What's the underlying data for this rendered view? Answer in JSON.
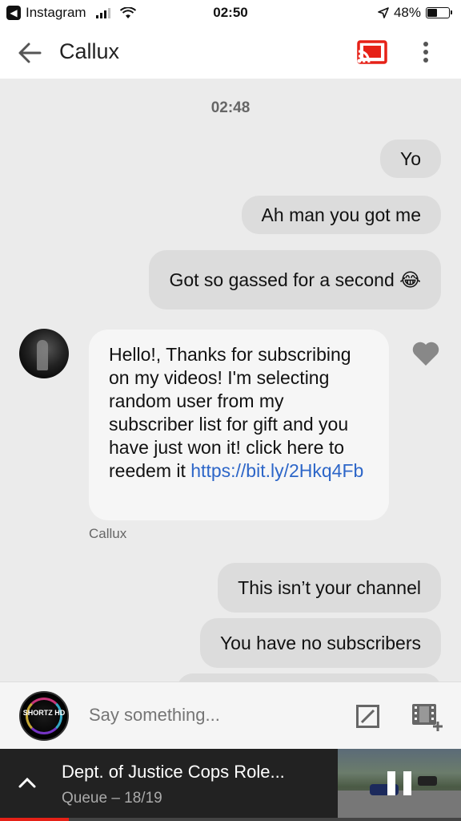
{
  "status_bar": {
    "app_name": "Instagram",
    "time": "02:50",
    "battery_percent": "48%",
    "battery_level": 0.48
  },
  "header": {
    "title": "Callux",
    "cast_color": "#e62117"
  },
  "chat": {
    "timestamp": "02:48",
    "outgoing_top": [
      {
        "text": "Yo"
      },
      {
        "text": "Ah man you got me"
      },
      {
        "text": "Got so gassed for a second 😂"
      }
    ],
    "incoming": {
      "text": "Hello!, Thanks for subscribing on my videos! I'm selecting random user from my subscriber list for gift and you have just won it! click here to reedem it ",
      "link": "https://bit.ly/2Hkq4Fb",
      "sender": "Callux"
    },
    "outgoing_bottom": [
      {
        "text": "This isn’t your channel"
      },
      {
        "text": "You have no subscribers"
      }
    ]
  },
  "composer": {
    "placeholder": "Say something...",
    "avatar_text": "SHORTZ HD"
  },
  "mini_player": {
    "title": "Dept. of Justice Cops Role...",
    "queue": "Queue – 18/19",
    "progress": 0.15
  }
}
